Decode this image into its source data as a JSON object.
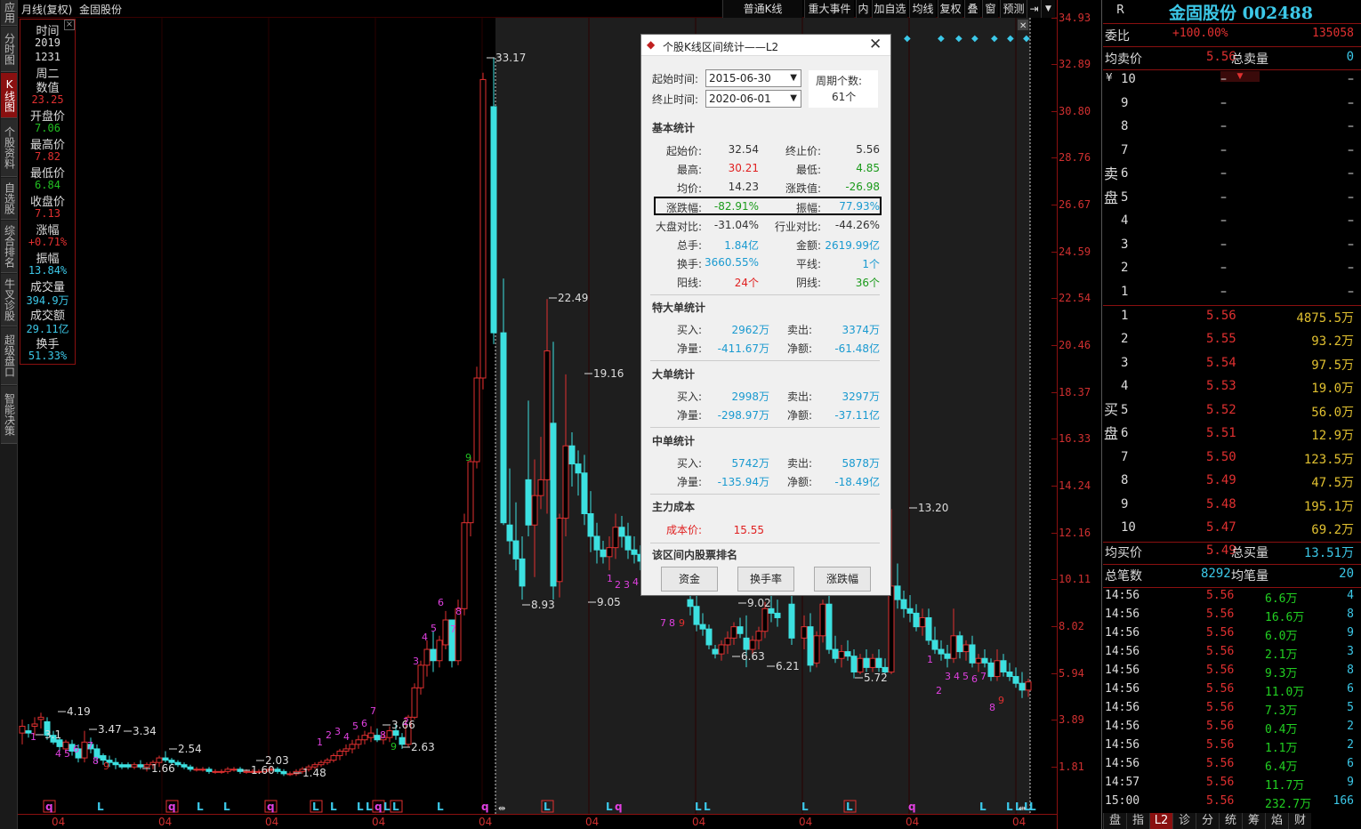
{
  "left_tabs": [
    "应用",
    "分时图",
    "K线图",
    "个股资料",
    "自选股",
    "综合排名",
    "牛叉诊股",
    "超级盘口",
    "智能决策"
  ],
  "top": {
    "period": "月线(复权)",
    "stock": "金固股份",
    "buttons": [
      "普通K线",
      "重大事件",
      "内",
      "加自选",
      "均线",
      "复权",
      "叠",
      "窗",
      "预测"
    ]
  },
  "info": {
    "time_label": "时间",
    "year": "2019",
    "date": "1231",
    "weekday": "周二",
    "value_label": "数值",
    "value": "23.25",
    "open_label": "开盘价",
    "open": "7.06",
    "high_label": "最高价",
    "high": "7.82",
    "low_label": "最低价",
    "low": "6.84",
    "close_label": "收盘价",
    "close": "7.13",
    "chg_label": "涨幅",
    "chg": "+0.71%",
    "amp_label": "振幅",
    "amp": "13.84%",
    "vol_label": "成交量",
    "vol": "394.9万",
    "amt_label": "成交额",
    "amt": "29.11亿",
    "turn_label": "换手",
    "turn": "51.33%"
  },
  "y_ticks": [
    "34.93",
    "32.89",
    "30.80",
    "28.76",
    "26.67",
    "24.59",
    "22.54",
    "20.46",
    "18.37",
    "16.33",
    "14.24",
    "12.16",
    "10.11",
    "8.02",
    "5.94",
    "3.89",
    "1.81"
  ],
  "x_ticks": [
    "04",
    "04",
    "04",
    "04",
    "04",
    "04",
    "04",
    "04",
    "04",
    "04"
  ],
  "chart_data": {
    "type": "candlestick",
    "price_labels": [
      "33.17",
      "22.49",
      "19.16",
      "8.93",
      "9.05",
      "9.02",
      "6.63",
      "6.21",
      "13.20",
      "5.72",
      "4.19",
      "3.47",
      "3.34",
      "3.1",
      "2.54",
      "2.03",
      "1.66",
      "1.60",
      "1.48",
      "3.66",
      "2.63"
    ],
    "bottom_markers": [
      "q",
      "L",
      "q",
      "L",
      "L",
      "q",
      "L",
      "L",
      "L",
      "L",
      "q",
      "L",
      "L",
      "L",
      "q",
      "L",
      "L",
      "q",
      "L",
      "L",
      "L",
      "L",
      "q",
      "L",
      "L",
      "L",
      "L",
      "L"
    ]
  },
  "dialog": {
    "title": "个股K线区间统计——L2",
    "start_label": "起始时间:",
    "start": "2015-06-30",
    "end_label": "终止时间:",
    "end": "2020-06-01",
    "period_label": "周期个数:",
    "period": "61个",
    "basic": {
      "title": "基本统计",
      "start_price_label": "起始价:",
      "start_price": "32.54",
      "end_price_label": "终止价:",
      "end_price": "5.56",
      "high_label": "最高:",
      "high": "30.21",
      "low_label": "最低:",
      "low": "4.85",
      "avg_label": "均价:",
      "avg": "14.23",
      "chg_value_label": "涨跌值:",
      "chg_value": "-26.98",
      "chg_pct_label": "涨跌幅:",
      "chg_pct": "-82.91%",
      "amp_label": "振幅:",
      "amp": "77.93%",
      "mkt_label": "大盘对比:",
      "mkt": "-31.04%",
      "ind_label": "行业对比:",
      "ind": "-44.26%",
      "vol_label": "总手:",
      "vol": "1.84亿",
      "amt_label": "金额:",
      "amt": "2619.99亿",
      "turn_label": "换手:",
      "turn": "3660.55%",
      "flat_label": "平线:",
      "flat": "1个",
      "up_label": "阳线:",
      "up": "24个",
      "down_label": "阴线:",
      "down": "36个"
    },
    "xl": {
      "title": "特大单统计",
      "buy_label": "买入:",
      "buy": "2962万",
      "sell_label": "卖出:",
      "sell": "3374万",
      "net_label": "净量:",
      "net": "-411.67万",
      "neta_label": "净额:",
      "neta": "-61.48亿"
    },
    "l": {
      "title": "大单统计",
      "buy_label": "买入:",
      "buy": "2998万",
      "sell_label": "卖出:",
      "sell": "3297万",
      "net_label": "净量:",
      "net": "-298.97万",
      "neta_label": "净额:",
      "neta": "-37.11亿"
    },
    "m": {
      "title": "中单统计",
      "buy_label": "买入:",
      "buy": "5742万",
      "sell_label": "卖出:",
      "sell": "5878万",
      "net_label": "净量:",
      "net": "-135.94万",
      "neta_label": "净额:",
      "neta": "-18.49亿"
    },
    "cost": {
      "title": "主力成本",
      "label": "成本价:",
      "value": "15.55"
    },
    "rank": {
      "title": "该区间内股票排名",
      "btn1": "资金",
      "btn2": "换手率",
      "btn3": "涨跌幅"
    }
  },
  "right": {
    "r": "R",
    "title": "金固股份 002488",
    "wb_label": "委比",
    "wb": "+100.00%",
    "wc": "135058",
    "avg_sell_label": "均卖价",
    "avg_sell": "5.56",
    "total_sell_label": "总卖量",
    "total_sell": "0",
    "ask_side": "卖盘",
    "bid_side": "买盘",
    "yen": "¥",
    "asks": [
      {
        "n": "10",
        "p": "–",
        "v": "–"
      },
      {
        "n": "9",
        "p": "–",
        "v": "–"
      },
      {
        "n": "8",
        "p": "–",
        "v": "–"
      },
      {
        "n": "7",
        "p": "–",
        "v": "–"
      },
      {
        "n": "6",
        "p": "–",
        "v": "–"
      },
      {
        "n": "5",
        "p": "–",
        "v": "–"
      },
      {
        "n": "4",
        "p": "–",
        "v": "–"
      },
      {
        "n": "3",
        "p": "–",
        "v": "–"
      },
      {
        "n": "2",
        "p": "–",
        "v": "–"
      },
      {
        "n": "1",
        "p": "–",
        "v": "–"
      }
    ],
    "bids": [
      {
        "n": "1",
        "p": "5.56",
        "v": "4875.5万"
      },
      {
        "n": "2",
        "p": "5.55",
        "v": "93.2万"
      },
      {
        "n": "3",
        "p": "5.54",
        "v": "97.5万"
      },
      {
        "n": "4",
        "p": "5.53",
        "v": "19.0万"
      },
      {
        "n": "5",
        "p": "5.52",
        "v": "56.0万"
      },
      {
        "n": "6",
        "p": "5.51",
        "v": "12.9万"
      },
      {
        "n": "7",
        "p": "5.50",
        "v": "123.5万"
      },
      {
        "n": "8",
        "p": "5.49",
        "v": "47.5万"
      },
      {
        "n": "9",
        "p": "5.48",
        "v": "195.1万"
      },
      {
        "n": "10",
        "p": "5.47",
        "v": "69.2万"
      }
    ],
    "avg_buy_label": "均买价",
    "avg_buy": "5.49",
    "total_buy_label": "总买量",
    "total_buy": "13.51万",
    "tick_count_label": "总笔数",
    "tick_count": "8292",
    "avg_tick_label": "均笔量",
    "avg_tick": "20",
    "ticks": [
      {
        "t": "14:56",
        "p": "5.56",
        "v": "6.6万",
        "n": "4"
      },
      {
        "t": "14:56",
        "p": "5.56",
        "v": "16.6万",
        "n": "8"
      },
      {
        "t": "14:56",
        "p": "5.56",
        "v": "6.0万",
        "n": "9"
      },
      {
        "t": "14:56",
        "p": "5.56",
        "v": "2.1万",
        "n": "3"
      },
      {
        "t": "14:56",
        "p": "5.56",
        "v": "9.3万",
        "n": "8"
      },
      {
        "t": "14:56",
        "p": "5.56",
        "v": "11.0万",
        "n": "6"
      },
      {
        "t": "14:56",
        "p": "5.56",
        "v": "7.3万",
        "n": "5"
      },
      {
        "t": "14:56",
        "p": "5.56",
        "v": "0.4万",
        "n": "2"
      },
      {
        "t": "14:56",
        "p": "5.56",
        "v": "1.1万",
        "n": "2"
      },
      {
        "t": "14:56",
        "p": "5.56",
        "v": "6.4万",
        "n": "6"
      },
      {
        "t": "14:57",
        "p": "5.56",
        "v": "11.7万",
        "n": "9"
      },
      {
        "t": "15:00",
        "p": "5.56",
        "v": "232.7万",
        "n": "166"
      }
    ],
    "bottom_tabs": [
      "盘",
      "指",
      "L2",
      "诊",
      "分",
      "统",
      "筹",
      "焰",
      "财"
    ]
  }
}
